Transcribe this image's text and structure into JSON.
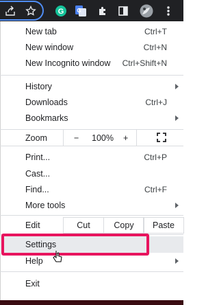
{
  "toolbar": {
    "icons": [
      "share-icon",
      "star-icon",
      "grammarly-icon",
      "translate-icon",
      "extensions-icon",
      "sidebar-icon",
      "profile-avatar",
      "kebab-menu-icon"
    ],
    "colors": {
      "background": "#202124",
      "grammarly": "#15c39a",
      "translate": "#4a80f0"
    }
  },
  "menu": {
    "new_tab": {
      "label": "New tab",
      "shortcut": "Ctrl+T"
    },
    "new_window": {
      "label": "New window",
      "shortcut": "Ctrl+N"
    },
    "new_incognito": {
      "label": "New Incognito window",
      "shortcut": "Ctrl+Shift+N"
    },
    "history": {
      "label": "History"
    },
    "downloads": {
      "label": "Downloads",
      "shortcut": "Ctrl+J"
    },
    "bookmarks": {
      "label": "Bookmarks"
    },
    "zoom": {
      "label": "Zoom",
      "minus": "−",
      "level": "100%",
      "plus": "+"
    },
    "print": {
      "label": "Print...",
      "shortcut": "Ctrl+P"
    },
    "cast": {
      "label": "Cast..."
    },
    "find": {
      "label": "Find...",
      "shortcut": "Ctrl+F"
    },
    "more_tools": {
      "label": "More tools"
    },
    "edit": {
      "label": "Edit",
      "cut": "Cut",
      "copy": "Copy",
      "paste": "Paste"
    },
    "settings": {
      "label": "Settings"
    },
    "help": {
      "label": "Help"
    },
    "exit": {
      "label": "Exit"
    }
  },
  "highlight_color": "#e8145e"
}
